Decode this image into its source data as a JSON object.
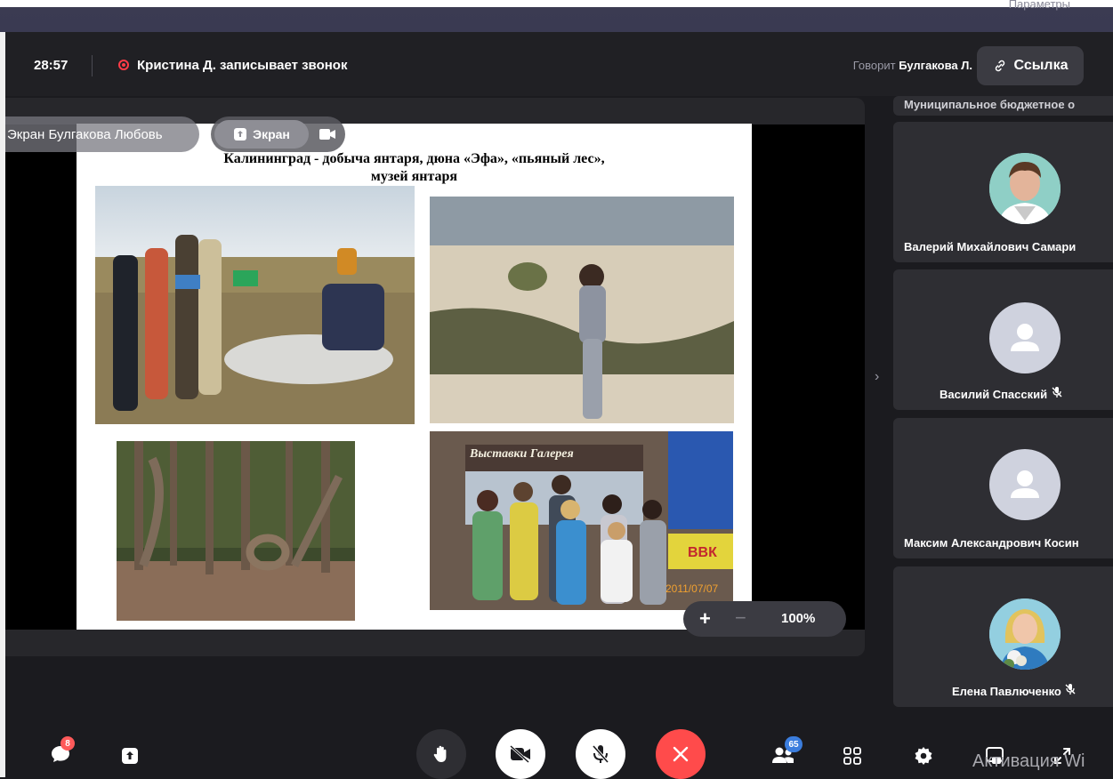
{
  "topbar": {
    "background_label": "Параметры"
  },
  "header": {
    "timer": "28:57",
    "recording_text": "Кристина Д. записывает звонок",
    "speaker_prefix": "Говорит",
    "speaker_name": "Булгакова Л.",
    "link_label": "Ссылка"
  },
  "screen_share": {
    "owner_label": "Экран Булгакова Любовь",
    "tab_screen_label": "Экран",
    "tab_camera_icon": "video-camera-icon"
  },
  "slide": {
    "title_line1": "Калининград - добыча янтаря, дюна «Эфа», «пьяный лес»,",
    "title_line2": "музей янтаря",
    "photo_sign_text": "Выставки Галерея",
    "photo_date_text": "2011/07/07",
    "photo_banner_text": "ВВК"
  },
  "zoom": {
    "plus": "+",
    "minus": "−",
    "level": "100%"
  },
  "participants": [
    {
      "name": "Муниципальное бюджетное о",
      "avatar": "none",
      "muted": false
    },
    {
      "name": "Валерий Михайлович Самари",
      "avatar": "photo",
      "muted": false
    },
    {
      "name": "Василий Спасский",
      "avatar": "placeholder",
      "muted": true
    },
    {
      "name": "Максим Александрович Косин",
      "avatar": "placeholder",
      "muted": false
    },
    {
      "name": "Елена Павлюченко",
      "avatar": "photo",
      "muted": true
    }
  ],
  "toolbar": {
    "chat_badge": "8",
    "participants_badge": "65",
    "icons": [
      "chat-icon",
      "share-screen-icon",
      "raise-hand-icon",
      "camera-off-icon",
      "mic-off-icon",
      "end-call-icon",
      "participants-icon",
      "grid-view-icon",
      "settings-icon",
      "pip-icon",
      "fullscreen-icon"
    ]
  },
  "os_overlay": {
    "activation_text": "Активация Wi"
  },
  "colors": {
    "end_call": "#ff4b4b",
    "record": "#ff3b47",
    "badge_blue": "#3b7ddd",
    "badge_red": "#ff5a5a"
  }
}
